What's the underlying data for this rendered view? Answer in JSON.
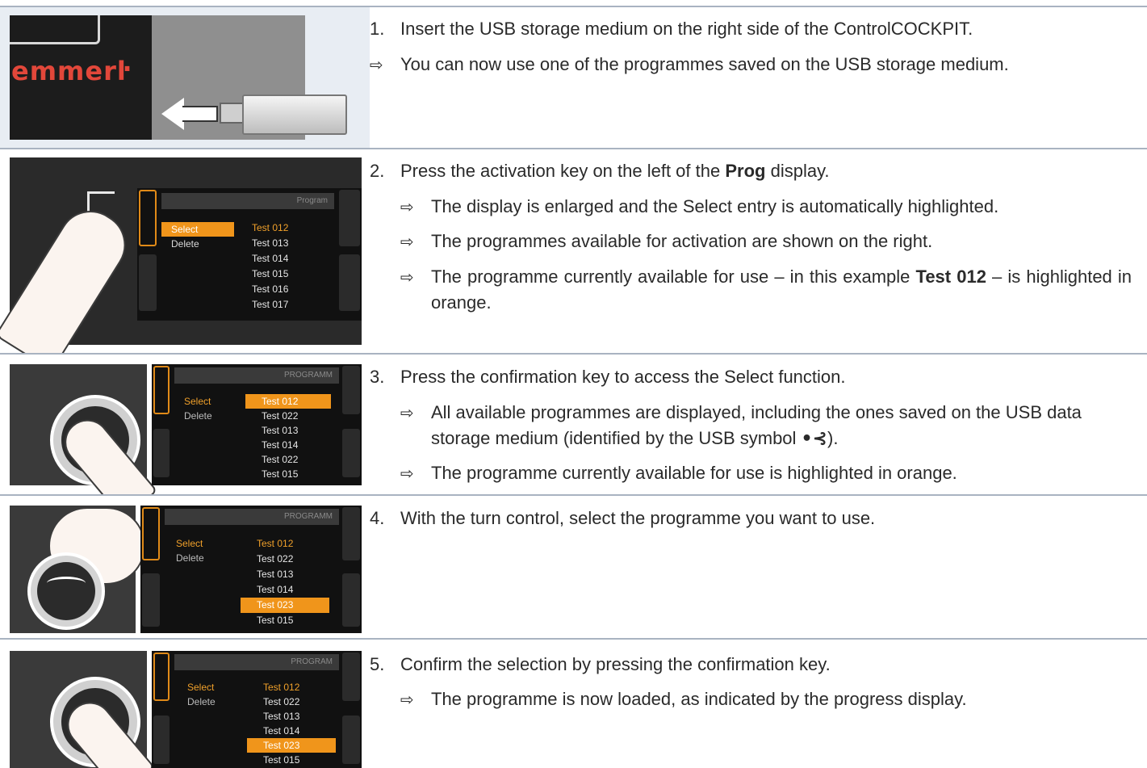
{
  "rows": [
    {
      "step_num": "1.",
      "step_text": "Insert the USB storage medium on the right side of the ControlCOCKPIT.",
      "results": [
        "You can now use one of the programmes saved on the USB storage medium."
      ]
    },
    {
      "step_num": "2.",
      "step_pre": "Press the activation key on the left of the ",
      "step_bold": "Prog",
      "step_post": " display.",
      "results": [
        "The display is enlarged and the Select entry is automatically highlighted.",
        "The programmes available for activation are shown on the right."
      ],
      "result3_pre": "The programme currently available for use – in this example ",
      "result3_bold": "Test 012",
      "result3_post": " – is highlighted in orange."
    },
    {
      "step_num": "3.",
      "step_text": "Press the confirmation key to access the Select function.",
      "result1_pre": "All available programmes are displayed, including the ones saved on the USB data storage medium (identified by the USB symbol ",
      "result1_symbol": "•⊰",
      "result1_post": ").",
      "results": [
        "The programme currently available for use is highlighted in orange."
      ]
    },
    {
      "step_num": "4.",
      "step_text": "With the turn control, select the programme you want to use."
    },
    {
      "step_num": "5.",
      "step_text": "Confirm the selection by pressing the confirmation key.",
      "results": [
        "The programme is now loaded, as indicated by the progress display."
      ]
    }
  ],
  "result_arrow": "⇨",
  "illustrations": {
    "brand": "emmerŀ",
    "screen2": {
      "header": "Program",
      "menu": [
        "Select",
        "Delete"
      ],
      "programs": [
        "Test 012",
        "Test 013",
        "Test 014",
        "Test 015",
        "Test 016",
        "Test 017"
      ]
    },
    "screen3": {
      "header": "PROGRAMM",
      "menu": [
        "Select",
        "Delete"
      ],
      "programs": [
        "Test 012",
        "Test 022",
        "Test 013",
        "Test 014",
        "Test 022",
        "Test 015"
      ]
    },
    "screen4": {
      "header": "PROGRAMM",
      "menu": [
        "Select",
        "Delete"
      ],
      "programs": [
        "Test 012",
        "Test 022",
        "Test 013",
        "Test 014",
        "Test 023",
        "Test 015"
      ]
    },
    "screen5": {
      "header": "PROGRAM",
      "menu": [
        "Select",
        "Delete"
      ],
      "programs": [
        "Test 012",
        "Test 022",
        "Test 013",
        "Test 014",
        "Test 023",
        "Test 015"
      ]
    },
    "usb_marker": "•⊰",
    "colors": {
      "highlight": "#f0951b",
      "rule": "#a9b3c1",
      "image_bg": "#e8edf3",
      "text": "#2a2a2a"
    }
  }
}
